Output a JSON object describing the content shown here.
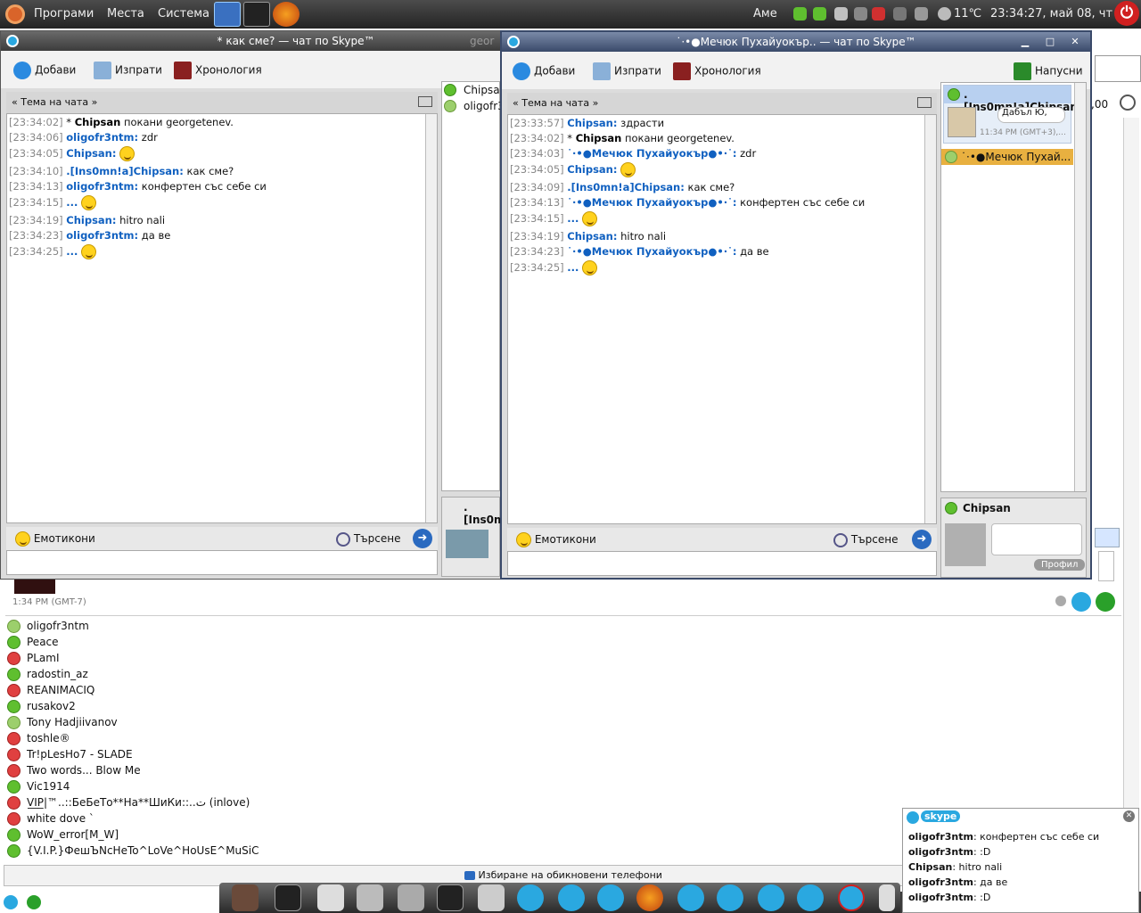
{
  "top_panel": {
    "menus": [
      "Програми",
      "Места",
      "Система"
    ],
    "keyboard": "Аме",
    "weather": "11℃",
    "clock": "23:34:27, май 08, чт"
  },
  "colors": {
    "skype_blue": "#1060c0",
    "online": "#5fbf2f",
    "dnd": "#e04040",
    "active_title": "#3a4a6a"
  },
  "win1": {
    "title": "* как сме? — чат по Skype™",
    "buttons": {
      "add": "Добави",
      "send": "Изпрати",
      "history": "Хронология"
    },
    "topic": "« Тема на чата »",
    "messages": [
      {
        "ts": "[23:34:02]",
        "who": "*",
        "name": "Chipsan",
        "text": "покани georgetenev.",
        "bold": true
      },
      {
        "ts": "[23:34:06]",
        "name": "oligofr3ntm:",
        "text": "zdr"
      },
      {
        "ts": "[23:34:05]",
        "name": "Chipsan:",
        "text": "",
        "smile": true
      },
      {
        "ts": "[23:34:10]",
        "name": ".[Ins0mn!a]Chipsan:",
        "text": "как сме?"
      },
      {
        "ts": "[23:34:13]",
        "name": "oligofr3ntm:",
        "text": "конфертен със себе си"
      },
      {
        "ts": "[23:34:15]",
        "name": "...",
        "text": "",
        "smile": true
      },
      {
        "ts": "[23:34:19]",
        "name": "Chipsan:",
        "text": "hitro nali"
      },
      {
        "ts": "[23:34:23]",
        "name": "oligofr3ntm:",
        "text": "да ве"
      },
      {
        "ts": "[23:34:25]",
        "name": "...",
        "text": "",
        "smile": true
      }
    ],
    "emoticons": "Емотикони",
    "search": "Търсене",
    "side": [
      "Chipsa",
      "oligofr3"
    ],
    "side_bottom": ".[Ins0m"
  },
  "win2": {
    "title": "˙·•●Мечюк Пухайуокър.. — чат по Skype™",
    "buttons": {
      "add": "Добави",
      "send": "Изпрати",
      "history": "Хронология",
      "leave": "Напусни"
    },
    "topic": "« Тема на чата »",
    "messages": [
      {
        "ts": "[23:33:57]",
        "name": "Chipsan:",
        "text": "здрасти"
      },
      {
        "ts": "[23:34:02]",
        "who": "*",
        "name": "Chipsan",
        "text": "покани georgetenev.",
        "bold": true
      },
      {
        "ts": "[23:34:03]",
        "name": "˙·•●Мечюк Пухайуокър●•·˙:",
        "text": "zdr"
      },
      {
        "ts": "[23:34:05]",
        "name": "Chipsan:",
        "text": "",
        "smile": true
      },
      {
        "ts": "[23:34:09]",
        "name": ".[Ins0mn!a]Chipsan:",
        "text": "как сме?"
      },
      {
        "ts": "[23:34:13]",
        "name": "˙·•●Мечюк Пухайуокър●•·˙:",
        "text": "конфертен със себе си"
      },
      {
        "ts": "[23:34:15]",
        "name": "...",
        "text": "",
        "smile": true
      },
      {
        "ts": "[23:34:19]",
        "name": "Chipsan:",
        "text": "hitro nali"
      },
      {
        "ts": "[23:34:23]",
        "name": "˙·•●Мечюк Пухайуокър●•·˙:",
        "text": "да ве"
      },
      {
        "ts": "[23:34:25]",
        "name": "...",
        "text": "",
        "smile": true
      }
    ],
    "emoticons": "Емотикони",
    "search": "Търсене",
    "participants": [
      {
        "name": ".[Ins0mn!a]Chipsan",
        "mood": "Дабъл Ю,",
        "time": "11:34 PM (GMT+3),..."
      },
      {
        "name": "˙·•●Мечюк Пухай..."
      }
    ],
    "profile_name": "Chipsan",
    "profile_btn": "Профил"
  },
  "main": {
    "time": "1:34 PM (GMT-7)",
    "zoom": ",00",
    "contacts": [
      {
        "name": "oligofr3ntm",
        "status": "away"
      },
      {
        "name": "Peace",
        "status": "on"
      },
      {
        "name": "PLamI",
        "status": "dnd"
      },
      {
        "name": "radostin_az",
        "status": "on"
      },
      {
        "name": "REANIMACIQ",
        "status": "dnd"
      },
      {
        "name": "rusakov2",
        "status": "on"
      },
      {
        "name": "Tony Hadjiivanov",
        "status": "away"
      },
      {
        "name": "toshle®",
        "status": "dnd"
      },
      {
        "name": "Tr!pLesHo7 - SLADE",
        "status": "dnd"
      },
      {
        "name": "Two words... Blow Me",
        "status": "dnd"
      },
      {
        "name": "Vic1914",
        "status": "on"
      },
      {
        "name": "V̲I̲P̲|™..::БеБеТо**На**ШиКи::..ت (inlove)",
        "status": "dnd"
      },
      {
        "name": "white dove `",
        "status": "dnd"
      },
      {
        "name": "WoW_error[M_W]",
        "status": "on"
      },
      {
        "name": "{V.I.P.}ФешЪNcHeTo^LoVe^HoUsE^MuSiC",
        "status": "on"
      }
    ],
    "phone_bar": "Избиране на обикновени телефони"
  },
  "popup": {
    "brand": "skype",
    "lines": [
      {
        "name": "oligofr3ntm",
        "text": ": конфертен със себе си"
      },
      {
        "name": "oligofr3ntm",
        "text": ": :D"
      },
      {
        "name": "Chipsan",
        "text": ": hitro nali"
      },
      {
        "name": "oligofr3ntm",
        "text": ": да ве"
      },
      {
        "name": "oligofr3ntm",
        "text": ": :D"
      }
    ]
  }
}
